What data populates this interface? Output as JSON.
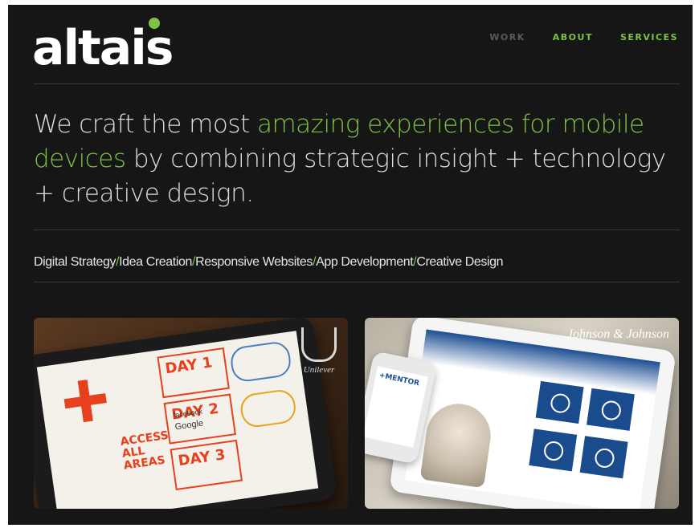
{
  "brand": {
    "logo_text": "altais",
    "accent": "#7ec242"
  },
  "nav": [
    {
      "label": "WORK",
      "active": false
    },
    {
      "label": "ABOUT",
      "active": true
    },
    {
      "label": "SERVICES",
      "active": true
    }
  ],
  "hero": {
    "part1": "We craft the most ",
    "highlight": "amazing experiences for mobile devices",
    "part2": " by combining strategic insight + technology + creative design."
  },
  "services": [
    "Digital Strategy",
    "Idea Creation",
    "Responsive Websites",
    "App Development",
    "Creative Design"
  ],
  "projects": [
    {
      "client": "Unilever",
      "screen_text": {
        "day1": "DAY 1",
        "day2": "DAY 2",
        "day3": "DAY 3",
        "access": "ACCESS ALL AREAS",
        "facebook": "facebook",
        "google": "Google"
      }
    },
    {
      "client": "Johnson & Johnson",
      "phone_brand": "+MENTOR"
    }
  ]
}
